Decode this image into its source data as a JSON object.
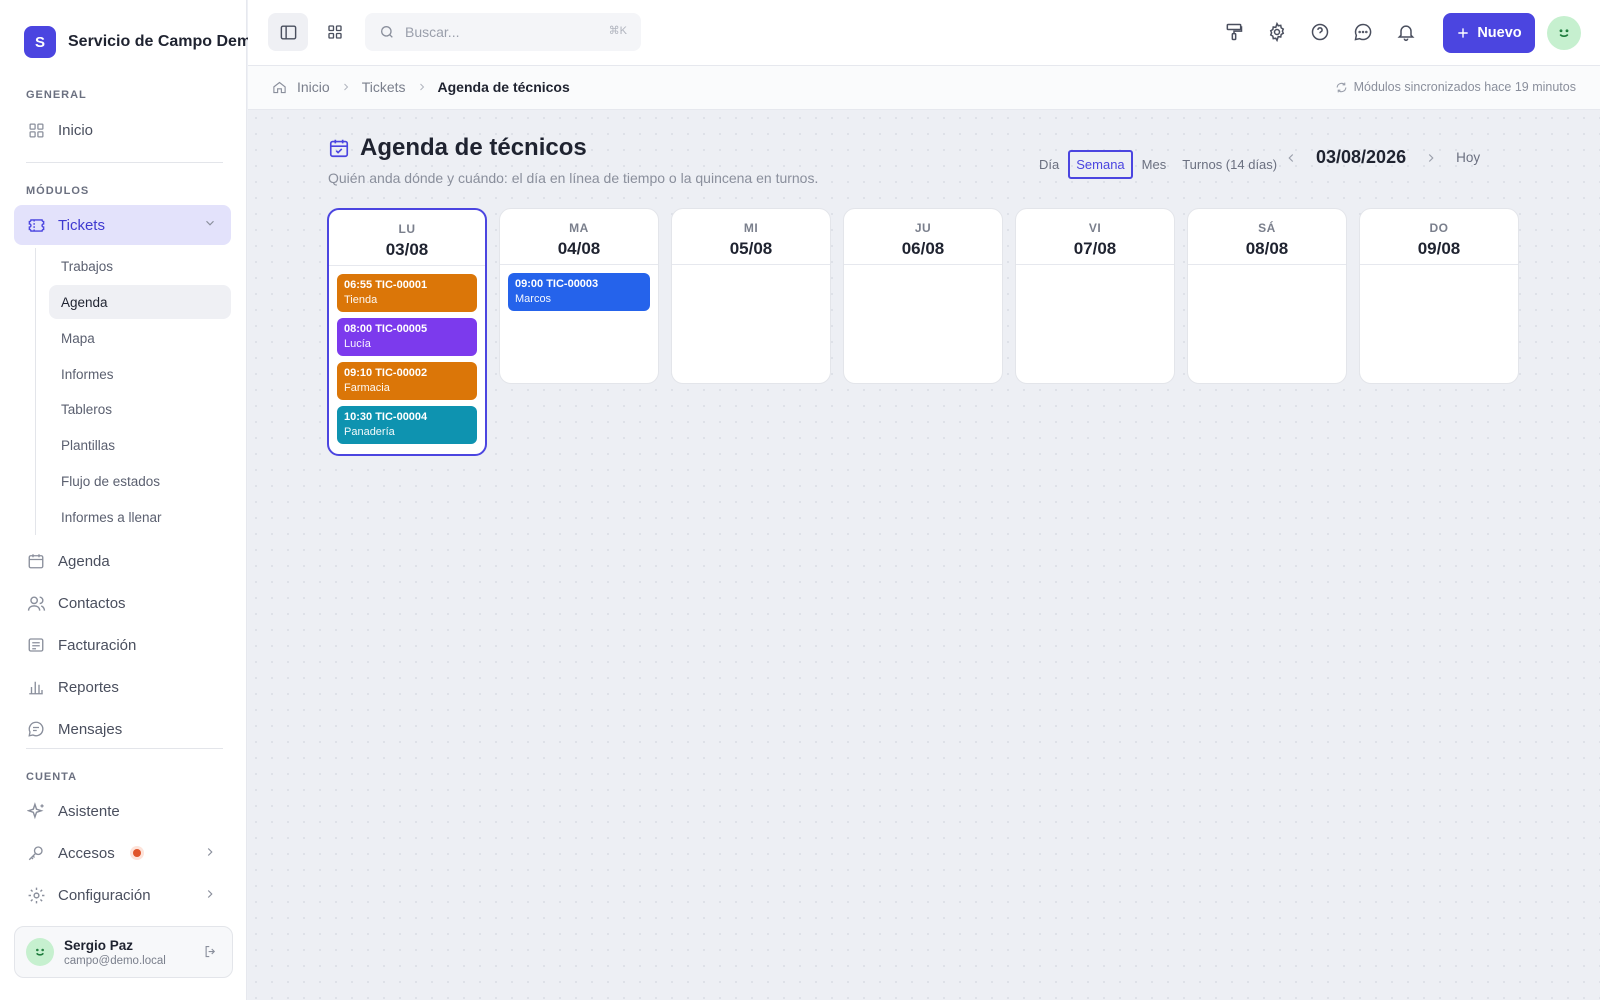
{
  "brand": {
    "logo": "S",
    "name": "Servicio de Campo Demo"
  },
  "sidebar": {
    "general_label": "GENERAL",
    "inicio": "Inicio",
    "modulos_label": "MÓDULOS",
    "tickets": "Tickets",
    "sub_items": [
      "Trabajos",
      "Agenda",
      "Mapa",
      "Informes",
      "Tableros",
      "Plantillas",
      "Flujo de estados",
      "Informes a llenar"
    ],
    "modules": [
      "Agenda",
      "Contactos",
      "Facturación",
      "Reportes",
      "Mensajes"
    ],
    "cuenta_label": "CUENTA",
    "account": [
      "Asistente",
      "Accesos",
      "Configuración"
    ]
  },
  "user": {
    "name": "Sergio Paz",
    "email": "campo@demo.local"
  },
  "topbar": {
    "search_placeholder": "Buscar...",
    "search_shortcut": "⌘K",
    "new_label": "Nuevo"
  },
  "breadcrumb": {
    "items": [
      "Inicio",
      "Tickets"
    ],
    "current": "Agenda de técnicos",
    "sync_status": "Módulos sincronizados hace 19 minutos"
  },
  "page": {
    "title": "Agenda de técnicos",
    "subtitle": "Quién anda dónde y cuándo: el día en línea de tiempo o la quincena en turnos.",
    "views": [
      "Día",
      "Semana",
      "Mes",
      "Turnos (14 días)"
    ],
    "active_view": "Semana",
    "date": "03/08/2026",
    "today_label": "Hoy"
  },
  "colors": {
    "accent": "#4b45e0",
    "orange": "#db7608",
    "purple": "#7c3aed",
    "blue": "#2563eb",
    "teal": "#0e93b0"
  },
  "week": [
    {
      "day": "LU",
      "date": "03/08",
      "selected": true,
      "events": [
        {
          "time": "06:55",
          "ticket": "TIC-00001",
          "label": "Tienda",
          "color": "#db7608"
        },
        {
          "time": "08:00",
          "ticket": "TIC-00005",
          "label": "Lucía",
          "color": "#7c3aed"
        },
        {
          "time": "09:10",
          "ticket": "TIC-00002",
          "label": "Farmacia",
          "color": "#db7608"
        },
        {
          "time": "10:30",
          "ticket": "TIC-00004",
          "label": "Panadería",
          "color": "#0e93b0"
        }
      ]
    },
    {
      "day": "MA",
      "date": "04/08",
      "events": [
        {
          "time": "09:00",
          "ticket": "TIC-00003",
          "label": "Marcos",
          "color": "#2563eb"
        }
      ]
    },
    {
      "day": "MI",
      "date": "05/08",
      "events": []
    },
    {
      "day": "JU",
      "date": "06/08",
      "events": []
    },
    {
      "day": "VI",
      "date": "07/08",
      "events": []
    },
    {
      "day": "SÁ",
      "date": "08/08",
      "events": []
    },
    {
      "day": "DO",
      "date": "09/08",
      "events": []
    }
  ]
}
